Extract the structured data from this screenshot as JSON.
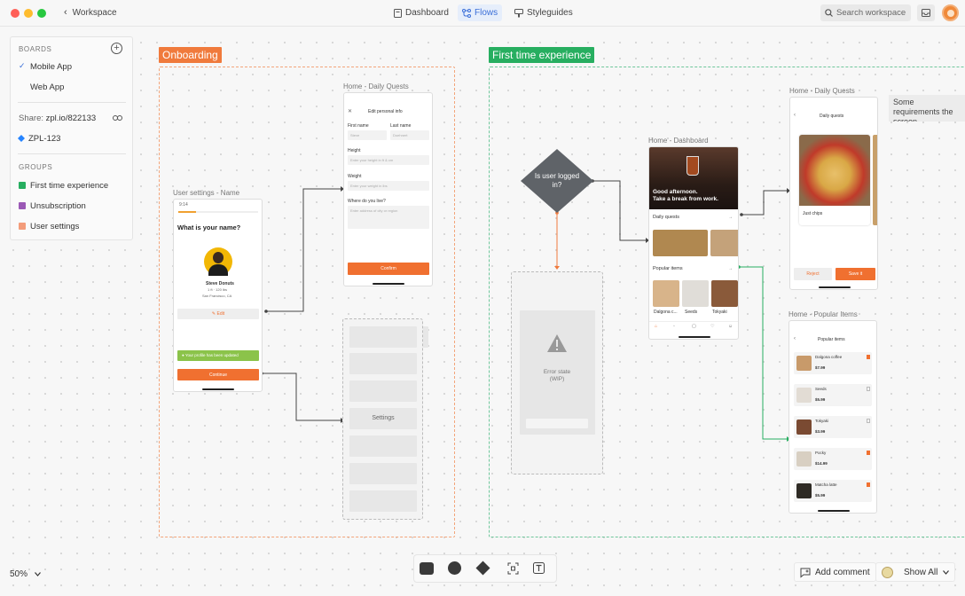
{
  "topbar": {
    "back_label": "Workspace",
    "tabs": [
      {
        "label": "Dashboard",
        "icon": "document-icon",
        "active": false
      },
      {
        "label": "Flows",
        "icon": "flow-icon",
        "active": true
      },
      {
        "label": "Styleguides",
        "icon": "brush-icon",
        "active": false
      }
    ],
    "search_placeholder": "Search workspace"
  },
  "sidebar": {
    "boards_heading": "BOARDS",
    "boards": [
      {
        "label": "Mobile App",
        "checked": true
      },
      {
        "label": "Web App",
        "checked": false
      }
    ],
    "share_label": "Share:",
    "share_link": "zpl.io/822133",
    "jira_key": "ZPL-123",
    "groups_heading": "GROUPS",
    "groups": [
      {
        "label": "First time experience",
        "color": "#27ae60"
      },
      {
        "label": "Unsubscription",
        "color": "#9b59b6"
      },
      {
        "label": "User settings",
        "color": "#f39c7a"
      }
    ]
  },
  "colors": {
    "onboarding": "#f07a3c",
    "first_time": "#27ae60",
    "accent_blue": "#3b6fd8"
  },
  "canvas": {
    "onboarding_label": "Onboarding",
    "first_time_label": "First time experience",
    "user_settings_name": {
      "label": "User settings - Name",
      "time": "9:14",
      "question": "What is your name?",
      "person_name": "Steve Donuts",
      "person_meta1": "1 ft · 120 lbs",
      "person_meta2": "San Francisco, CA",
      "edit_label": "Edit",
      "toast": "Your profile has been updated",
      "continue": "Continue"
    },
    "home_daily_quests_left": {
      "label": "Home - Daily Quests",
      "title": "Edit personal info",
      "first_name": "First name",
      "last_name": "Last name",
      "first_name_ph": "Steve",
      "last_name_ph": "Doehnert",
      "height": "Height",
      "height_ph": "Enter your height in ft & cm",
      "weight": "Weight",
      "weight_ph": "Enter your weight in lbs",
      "where": "Where do you live?",
      "where_ph": "Enter address of city or region",
      "confirm": "Confirm"
    },
    "settings_label": "Settings",
    "decision": "Is user logged in?",
    "error_state": "Error state (WIP)",
    "home_dashboard": {
      "label": "Home - Dashboard",
      "greeting_line1": "Good afternoon.",
      "greeting_line2": "Take a break from work.",
      "daily_quests": "Daily quests",
      "popular_items": "Popular items",
      "items": [
        "Dalgona c...",
        "Seeds",
        "Tokyaki"
      ]
    },
    "home_daily_quests_right": {
      "label": "Home - Daily Quests",
      "title": "Daily quests",
      "card_title": "Just chips",
      "reject": "Reject",
      "save": "Save it"
    },
    "home_popular_items": {
      "label": "Home - Popular Items",
      "title": "Popular items",
      "rows": [
        {
          "name": "Dalgona coffee",
          "price": "$7.99"
        },
        {
          "name": "Seeds",
          "price": "$5.99"
        },
        {
          "name": "Tokyaki",
          "price": "$3.99"
        },
        {
          "name": "Pocky",
          "price": "$14.99"
        },
        {
          "name": "Matcha latte",
          "price": "$5.99"
        }
      ]
    },
    "note": "Some requirements the screen."
  },
  "bottom": {
    "zoom": "50%",
    "add_comment": "Add comment",
    "show_all": "Show All"
  }
}
